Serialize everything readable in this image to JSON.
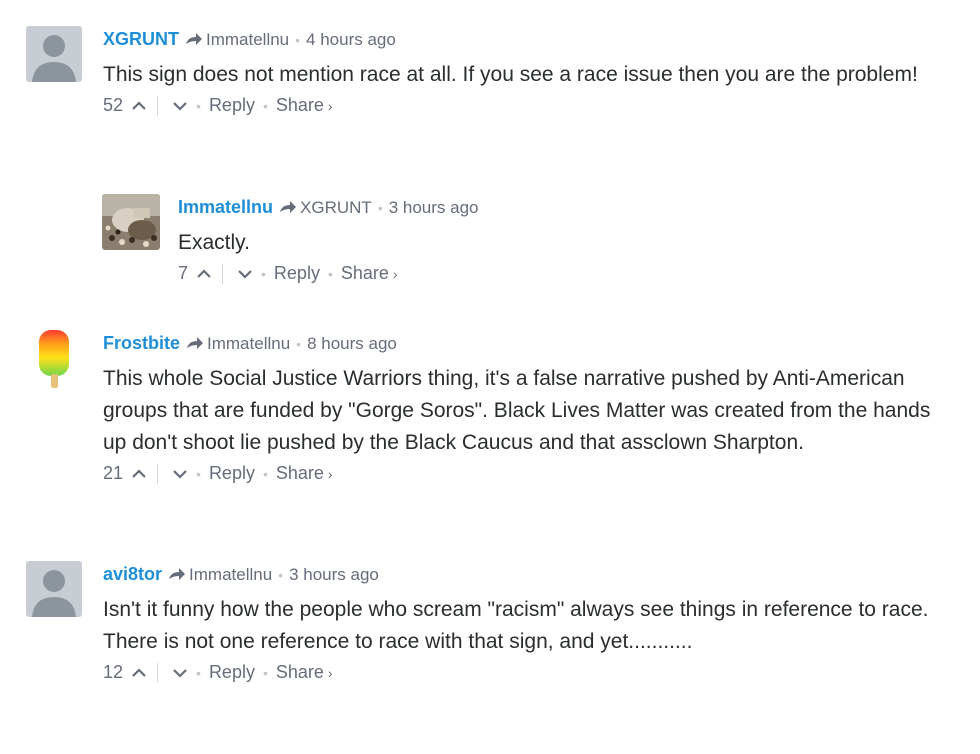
{
  "comments": [
    {
      "author": "XGRUNT",
      "reply_to": "Immatellnu",
      "time": "4 hours ago",
      "message": "This sign does not mention race at all. If you see a race issue then you are the problem!",
      "votes": "52",
      "reply_label": "Reply",
      "share_label": "Share",
      "avatar": "default-avatar"
    },
    {
      "author": "Immatellnu",
      "reply_to": "XGRUNT",
      "time": "3 hours ago",
      "message": "Exactly.",
      "votes": "7",
      "reply_label": "Reply",
      "share_label": "Share",
      "avatar": "photo-avatar"
    },
    {
      "author": "Frostbite",
      "reply_to": "Immatellnu",
      "time": "8 hours ago",
      "message": "This whole Social Justice Warriors thing, it's a false narrative pushed by Anti-American groups that are funded by \"Gorge Soros\". Black Lives Matter was created from the hands up don't shoot lie pushed by the Black Caucus and that assclown Sharpton.",
      "votes": "21",
      "reply_label": "Reply",
      "share_label": "Share",
      "avatar": "popsicle-avatar"
    },
    {
      "author": "avi8tor",
      "reply_to": "Immatellnu",
      "time": "3 hours ago",
      "message": "Isn't it funny how the people who scream \"racism\" always see things in reference to race. There is not one reference to race with that sign, and yet...........",
      "votes": "12",
      "reply_label": "Reply",
      "share_label": "Share",
      "avatar": "default-avatar"
    }
  ],
  "colors": {
    "author_link": "#1e8fd6",
    "meta_text": "#656c7a",
    "body_text": "#2a2e2e",
    "default_avatar_bg": "#c7cdd2",
    "default_avatar_fg": "#8c959d"
  }
}
